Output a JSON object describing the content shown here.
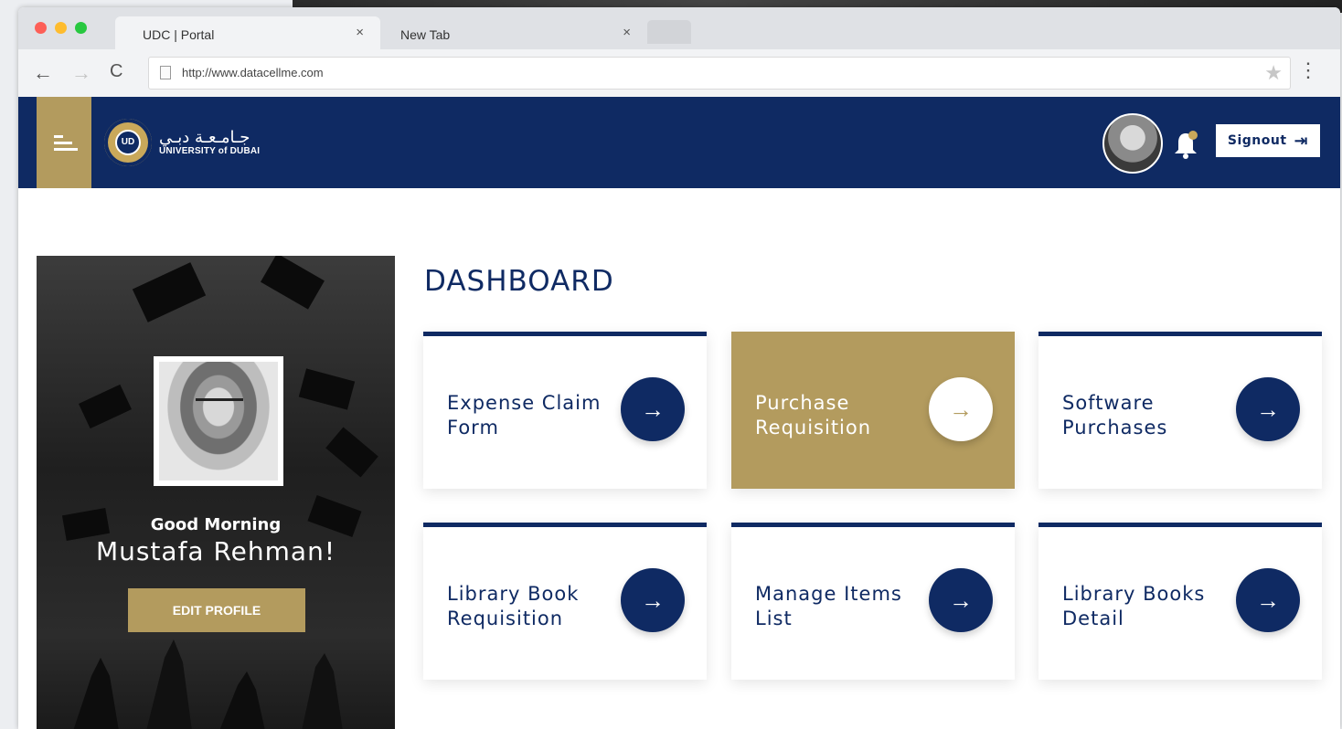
{
  "browser": {
    "tabs": [
      {
        "label": "UDC | Portal",
        "close": "×"
      },
      {
        "label": "New Tab",
        "close": "×"
      }
    ],
    "url": "http://www.datacellme.com",
    "nav": {
      "back": "←",
      "forward": "→",
      "reload": "C"
    },
    "star": "★",
    "menu": "⋮"
  },
  "header": {
    "logo_ar": "جـامـعـة دبـي",
    "logo_en": "UNIVERSITY of DUBAI",
    "seal_letters": "UD",
    "signout_label": "Signout",
    "signout_icon": "⇥"
  },
  "profile": {
    "greeting": "Good Morning",
    "name": "Mustafa Rehman!",
    "edit_label": "EDIT PROFILE"
  },
  "dashboard": {
    "title": "DASHBOARD",
    "arrow": "→",
    "cards": [
      {
        "label": "Expense Claim Form"
      },
      {
        "label": "Purchase Requisition"
      },
      {
        "label": "Software Purchases"
      },
      {
        "label": "Library Book Requisition"
      },
      {
        "label": "Manage Items List"
      },
      {
        "label": "Library Books Detail"
      }
    ]
  },
  "colors": {
    "navy": "#0f2a63",
    "gold": "#b39b5e",
    "notification_dot": "#c9a85a"
  }
}
